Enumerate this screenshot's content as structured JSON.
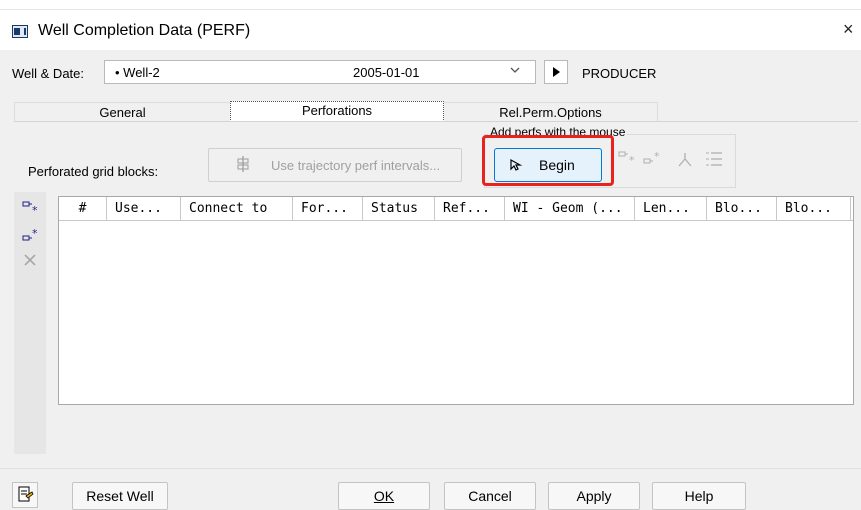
{
  "window": {
    "title": "Well Completion Data (PERF)",
    "close_glyph": "×"
  },
  "well_row": {
    "label": "Well & Date:",
    "well_value": "• Well-2",
    "date_value": "2005-01-01",
    "type": "PRODUCER"
  },
  "tabs": [
    {
      "label": "General",
      "selected": false
    },
    {
      "label": "Perforations",
      "selected": true
    },
    {
      "label": "Rel.Perm.Options",
      "selected": false
    }
  ],
  "perf": {
    "perforated_label": "Perforated grid blocks:",
    "trajectory_button": "Use trajectory perf intervals...",
    "add_perfs_label": "Add perfs with the mouse",
    "begin_button": "Begin"
  },
  "table": {
    "columns": [
      "#",
      "Use...",
      "Connect to",
      "For...",
      "Status",
      "Ref...",
      "WI - Geom (...",
      "Len...",
      "Blo...",
      "Blo..."
    ],
    "rows": []
  },
  "buttons": {
    "reset": "Reset Well",
    "ok": "OK",
    "cancel": "Cancel",
    "apply": "Apply",
    "help": "Help"
  },
  "colors": {
    "highlight": "#e8231e",
    "begin_bg": "#e5f1fb",
    "begin_border": "#0078d7",
    "dialog_bg": "#f0f0f0"
  },
  "icons": [
    "app-icon",
    "close-icon",
    "play-icon",
    "trajectory-icon",
    "cursor-icon",
    "add-perf-icon",
    "insert-perf-icon",
    "delete-perf-icon",
    "tree-icon",
    "list-icon",
    "notepad-icon"
  ]
}
